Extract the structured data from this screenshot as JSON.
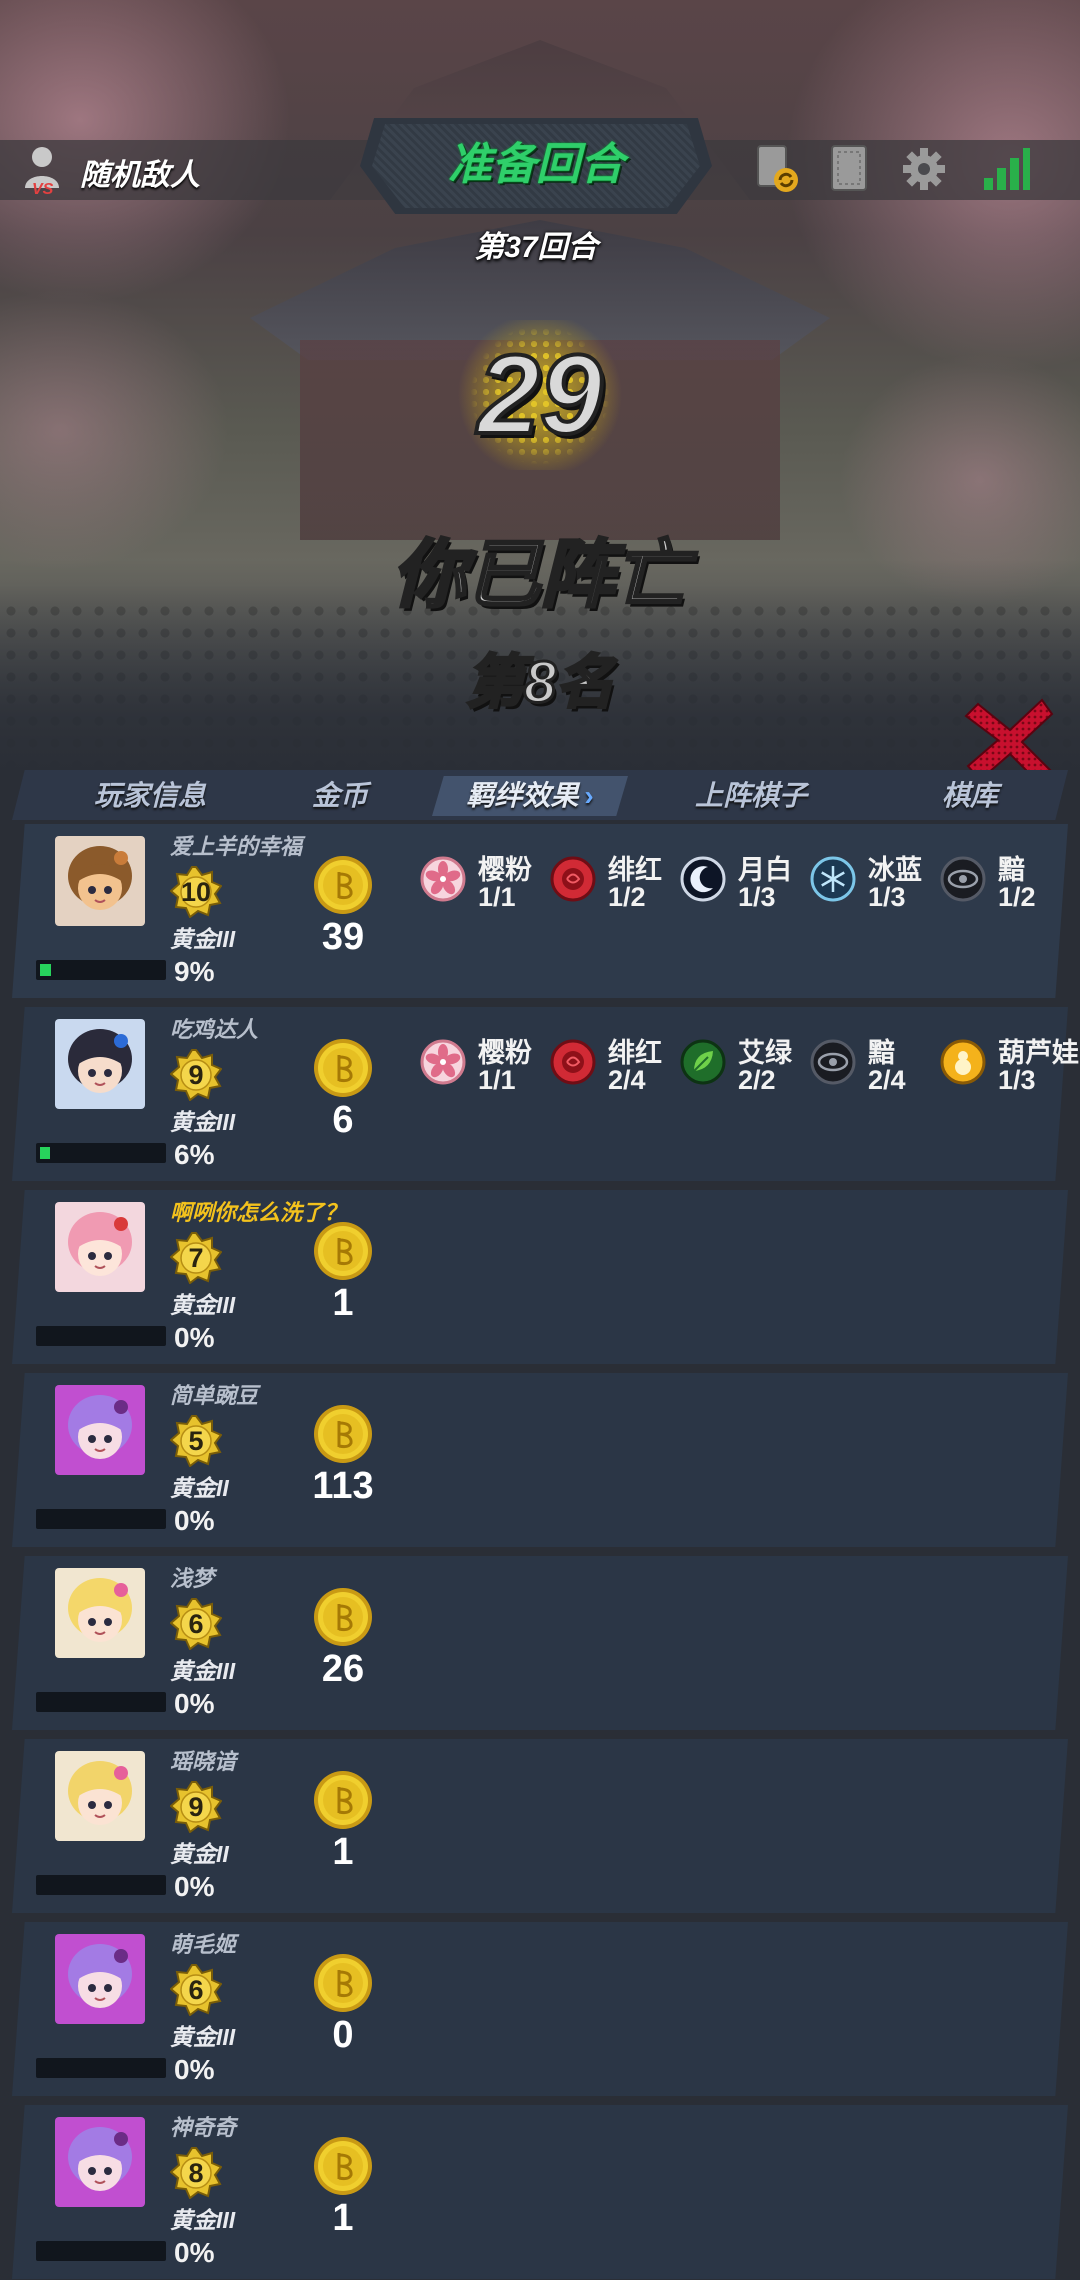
{
  "header": {
    "enemy_label": "随机敌人",
    "phase_title": "准备回合",
    "round_label": "第37回合",
    "countdown": "29",
    "status_text": "你已阵亡",
    "rank_text": "第8名"
  },
  "tabs": [
    {
      "label": "玩家信息"
    },
    {
      "label": "金币"
    },
    {
      "label": "羁绊效果"
    },
    {
      "label": "上阵棋子"
    },
    {
      "label": "棋库"
    }
  ],
  "tab_chevron": "›",
  "players": [
    {
      "name": "爱上羊的幸福",
      "level": "10",
      "rank": "黄金III",
      "percent": "9%",
      "progress": 0.09,
      "gold": "39",
      "bonds": [
        {
          "name": "樱粉",
          "value": "1/1",
          "icon": "sakura-icon"
        },
        {
          "name": "绯红",
          "value": "1/2",
          "icon": "rose-icon"
        },
        {
          "name": "月白",
          "value": "1/3",
          "icon": "moon-icon"
        },
        {
          "name": "冰蓝",
          "value": "1/3",
          "icon": "snowflake-icon"
        },
        {
          "name": "黯",
          "value": "1/2",
          "icon": "eye-icon"
        }
      ]
    },
    {
      "name": "吃鸡达人",
      "level": "9",
      "rank": "黄金III",
      "percent": "6%",
      "progress": 0.06,
      "gold": "6",
      "bonds": [
        {
          "name": "樱粉",
          "value": "1/1",
          "icon": "sakura-icon"
        },
        {
          "name": "绯红",
          "value": "2/4",
          "icon": "rose-icon"
        },
        {
          "name": "艾绿",
          "value": "2/2",
          "icon": "leaf-icon"
        },
        {
          "name": "黯",
          "value": "2/4",
          "icon": "eye-icon"
        },
        {
          "name": "葫芦娃",
          "value": "1/3",
          "icon": "gourd-icon"
        }
      ]
    },
    {
      "name": "啊咧你怎么洗了？",
      "level": "7",
      "rank": "黄金III",
      "percent": "0%",
      "progress": 0,
      "gold": "1",
      "bonds": []
    },
    {
      "name": "简单豌豆",
      "level": "5",
      "rank": "黄金II",
      "percent": "0%",
      "progress": 0,
      "gold": "113",
      "bonds": []
    },
    {
      "name": "浅梦",
      "level": "6",
      "rank": "黄金III",
      "percent": "0%",
      "progress": 0,
      "gold": "26",
      "bonds": []
    },
    {
      "name": "瑶晓谙",
      "level": "9",
      "rank": "黄金II",
      "percent": "0%",
      "progress": 0,
      "gold": "1",
      "bonds": []
    },
    {
      "name": "萌毛姬",
      "level": "6",
      "rank": "黄金III",
      "percent": "0%",
      "progress": 0,
      "gold": "0",
      "bonds": []
    },
    {
      "name": "神奇奇",
      "level": "8",
      "rank": "黄金III",
      "percent": "0%",
      "progress": 0,
      "gold": "1",
      "bonds": []
    }
  ],
  "colors": {
    "phase_green": "#2fcf6a",
    "progress_green": "#27d35c",
    "highlight_name": "#f3c21d",
    "row_bg": "#2b3646",
    "coin_gold": "#e9c52a"
  }
}
